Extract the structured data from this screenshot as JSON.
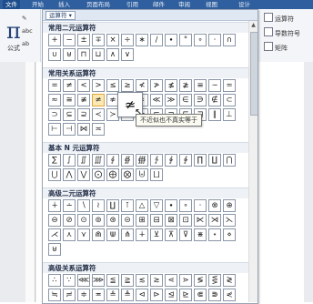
{
  "ribbon": {
    "tabs": [
      "文件",
      "开始",
      "插入",
      "页面布局",
      "引用",
      "邮件",
      "审阅",
      "视图",
      "设计"
    ],
    "active_tab": "文件",
    "equation_label": "公式",
    "tools_label": "工具",
    "right_items": [
      "运算符",
      "导数符号",
      "矩阵"
    ]
  },
  "gallery": {
    "dropdown_label": "运算符",
    "sections": [
      {
        "title": "常用二元运算符",
        "rows": [
          [
            "+",
            "−",
            "±",
            "∓",
            "×",
            "÷",
            "∗",
            "∕",
            "∙",
            "°",
            "∘",
            "⋅",
            "∩"
          ],
          [
            "∪",
            "⊎",
            "⊓",
            "⊔",
            "∧",
            "∨"
          ]
        ]
      },
      {
        "title": "常用关系运算符",
        "rows": [
          [
            "=",
            "≠",
            "<",
            ">",
            "≤",
            "≥",
            "≮",
            "≯",
            "≰",
            "≱",
            "≡",
            "∼",
            "≃"
          ],
          [
            "≈",
            "≅",
            "≢",
            "≄",
            "≉",
            "≇",
            "∝",
            "≪",
            "≫",
            "∈",
            "∋",
            "∉",
            "⊂"
          ],
          [
            "⊃",
            "⊆",
            "⊇",
            "≺",
            "≻",
            "≼",
            "≽",
            "⊏",
            "⊐",
            "⊑",
            "⊒",
            "∥",
            "⊥"
          ],
          [
            "⊢",
            "⊣",
            "⋈",
            "≍"
          ]
        ]
      },
      {
        "title": "基本 N 元运算符",
        "rows": [
          [
            "∑",
            "∫",
            "∬",
            "∭",
            "∮",
            "∯",
            "∰",
            "∱",
            "∲",
            "∳",
            "∏",
            "∐",
            "⋂"
          ],
          [
            "⋃",
            "⋀",
            "⋁",
            "⨀",
            "⨁",
            "⨂",
            "⨄",
            "⨆"
          ]
        ]
      },
      {
        "title": "高级二元运算符",
        "rows": [
          [
            "∔",
            "∸",
            "∖",
            "≀",
            "∐",
            "⊺",
            "△",
            "▽",
            "∙",
            "∘",
            "⋅",
            "⊗",
            "⊕"
          ],
          [
            "⊖",
            "⊘",
            "⊙",
            "⊚",
            "⊛",
            "⊝",
            "⊞",
            "⊟",
            "⊠",
            "⊡",
            "⋉",
            "⋊",
            "⋋"
          ],
          [
            "⋌",
            "⋏",
            "⋎",
            "⋒",
            "⋓",
            "⋔",
            "∔",
            "⊻",
            "⊼",
            "⊽",
            "⋇",
            "⋆",
            "⋄"
          ],
          [
            "⊎"
          ]
        ]
      },
      {
        "title": "高级关系运算符",
        "rows": [
          [
            "∴",
            "∵",
            "⋘",
            "⋙",
            "≦",
            "≧",
            "≲",
            "≳",
            "⋖",
            "⋗",
            "≶",
            "⋚",
            "≷"
          ],
          [
            "≒",
            "≓",
            "≑",
            "≖",
            "≗",
            "≜",
            "⊲",
            "⊳",
            "⊴",
            "⊵",
            "⋐",
            "⋑",
            "⋞"
          ]
        ]
      }
    ],
    "hovered_symbol": "≄",
    "tooltip": "不近似也不真实等于"
  }
}
